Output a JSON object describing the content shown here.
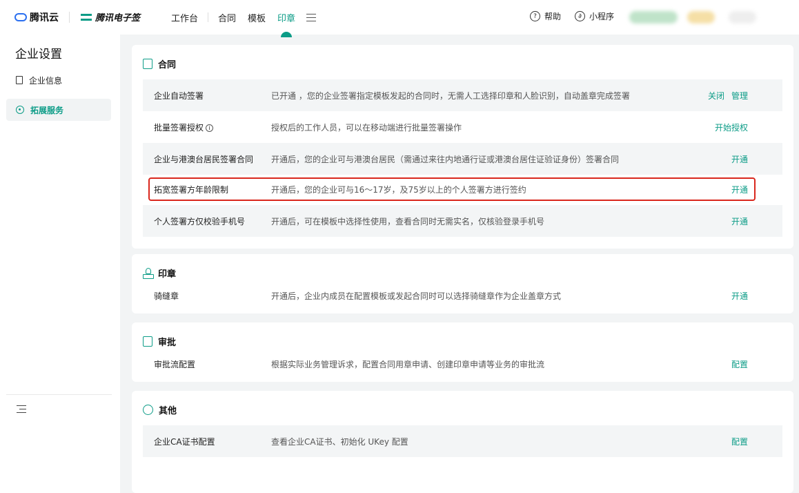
{
  "header": {
    "brand_cloud": "腾讯云",
    "brand_esign": "腾讯电子签",
    "nav": [
      "工作台",
      "合同",
      "模板",
      "印章"
    ],
    "help": "帮助",
    "miniprogram": "小程序"
  },
  "sidebar": {
    "title": "企业设置",
    "items": [
      {
        "label": "企业信息"
      },
      {
        "label": "拓展服务"
      }
    ]
  },
  "sections": {
    "contract": {
      "title": "合同",
      "rows": [
        {
          "name": "企业自动签署",
          "desc": "已开通 ，您的企业签署指定模板发起的合同时，无需人工选择印章和人脸识别，自动盖章完成签署",
          "actions": [
            "关闭",
            "管理"
          ]
        },
        {
          "name": "批量签署授权",
          "desc": "授权后的工作人员，可以在移动端进行批量签署操作",
          "actions": [
            "开始授权"
          ]
        },
        {
          "name": "企业与港澳台居民签署合同",
          "desc": "开通后，您的企业可与港澳台居民（需通过来往内地通行证或港澳台居住证验证身份）签署合同",
          "actions": [
            "开通"
          ]
        },
        {
          "name": "拓宽签署方年龄限制",
          "desc": "开通后，您的企业可与16～17岁，及75岁以上的个人签署方进行签约",
          "actions": [
            "开通"
          ]
        },
        {
          "name": "个人签署方仅校验手机号",
          "desc": "开通后，可在模板中选择性使用，查看合同时无需实名，仅核验登录手机号",
          "actions": [
            "开通"
          ]
        }
      ]
    },
    "seal": {
      "title": "印章",
      "rows": [
        {
          "name": "骑缝章",
          "desc": "开通后，企业内成员在配置模板或发起合同时可以选择骑缝章作为企业盖章方式",
          "actions": [
            "开通"
          ]
        }
      ]
    },
    "approval": {
      "title": "审批",
      "rows": [
        {
          "name": "审批流配置",
          "desc": "根据实际业务管理诉求，配置合同用章申请、创建印章申请等业务的审批流",
          "actions": [
            "配置"
          ]
        }
      ]
    },
    "other": {
      "title": "其他",
      "rows": [
        {
          "name": "企业CA证书配置",
          "desc": "查看企业CA证书、初始化 UKey 配置",
          "actions": [
            "配置"
          ]
        }
      ]
    }
  },
  "colors": {
    "accent": "#0c9c87",
    "highlight": "#d9261c"
  }
}
